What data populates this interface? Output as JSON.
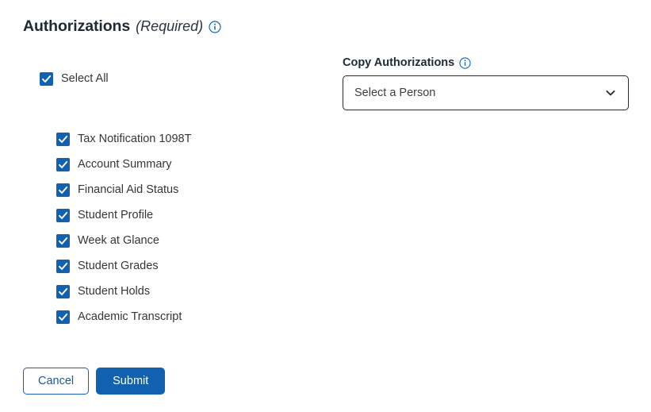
{
  "header": {
    "title": "Authorizations",
    "required_note": "(Required)",
    "info_icon": "info-circle-icon"
  },
  "select_all": {
    "label": "Select All",
    "checked": true
  },
  "authorizations": [
    {
      "label": "Tax Notification 1098T",
      "checked": true
    },
    {
      "label": "Account Summary",
      "checked": true
    },
    {
      "label": "Financial Aid Status",
      "checked": true
    },
    {
      "label": "Student Profile",
      "checked": true
    },
    {
      "label": "Week at Glance",
      "checked": true
    },
    {
      "label": "Student Grades",
      "checked": true
    },
    {
      "label": "Student Holds",
      "checked": true
    },
    {
      "label": "Academic Transcript",
      "checked": true
    }
  ],
  "copy_authorizations": {
    "label": "Copy Authorizations",
    "info_icon": "info-circle-icon",
    "select": {
      "value": "Select a Person",
      "chevron_icon": "chevron-down-icon"
    }
  },
  "actions": {
    "cancel_label": "Cancel",
    "submit_label": "Submit"
  },
  "colors": {
    "accent_blue": "#1161b0",
    "link_blue": "#19599f",
    "heading": "#1f2a37",
    "body_text": "#333739",
    "border_dark": "#25282b",
    "background": "#ffffff"
  }
}
